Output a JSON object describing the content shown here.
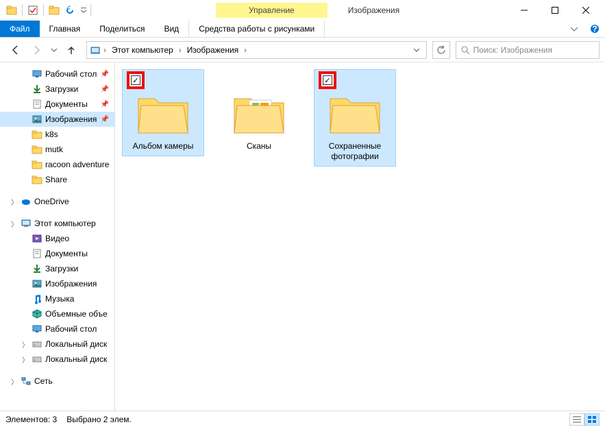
{
  "titlebar": {
    "context_tab": "Управление",
    "window_title": "Изображения"
  },
  "ribbon": {
    "file": "Файл",
    "tabs": [
      "Главная",
      "Поделиться",
      "Вид"
    ],
    "tools_tab": "Средства работы с рисунками"
  },
  "address": {
    "crumbs": [
      "Этот компьютер",
      "Изображения"
    ]
  },
  "search": {
    "placeholder": "Поиск: Изображения"
  },
  "sidebar": {
    "quick": [
      {
        "label": "Рабочий стол",
        "icon": "desktop",
        "pinned": true
      },
      {
        "label": "Загрузки",
        "icon": "downloads",
        "pinned": true
      },
      {
        "label": "Документы",
        "icon": "documents",
        "pinned": true
      },
      {
        "label": "Изображения",
        "icon": "pictures",
        "pinned": true,
        "selected": true
      },
      {
        "label": "k8s",
        "icon": "folder"
      },
      {
        "label": "mutk",
        "icon": "folder"
      },
      {
        "label": "racoon adventure",
        "icon": "folder"
      },
      {
        "label": "Share",
        "icon": "folder"
      }
    ],
    "onedrive": "OneDrive",
    "pc": "Этот компьютер",
    "pc_items": [
      {
        "label": "Видео",
        "icon": "videos"
      },
      {
        "label": "Документы",
        "icon": "documents"
      },
      {
        "label": "Загрузки",
        "icon": "downloads"
      },
      {
        "label": "Изображения",
        "icon": "pictures"
      },
      {
        "label": "Музыка",
        "icon": "music"
      },
      {
        "label": "Объемные объе",
        "icon": "objects3d"
      },
      {
        "label": "Рабочий стол",
        "icon": "desktop"
      },
      {
        "label": "Локальный диск",
        "icon": "disk"
      },
      {
        "label": "Локальный диск",
        "icon": "disk"
      }
    ],
    "network": "Сеть"
  },
  "items": [
    {
      "label": "Альбом камеры",
      "selected": true,
      "checked": true,
      "highlight": true
    },
    {
      "label": "Сканы",
      "selected": false,
      "checked": false,
      "highlight": false
    },
    {
      "label": "Сохраненные фотографии",
      "selected": true,
      "checked": true,
      "highlight": true
    }
  ],
  "statusbar": {
    "count": "Элементов: 3",
    "selected": "Выбрано 2 элем."
  }
}
